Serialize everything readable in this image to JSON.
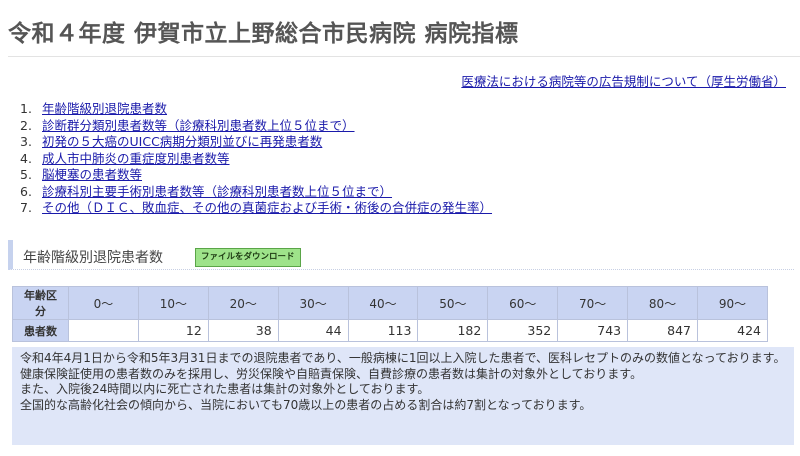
{
  "page": {
    "title": "令和４年度 伊賀市立上野総合市民病院 病院指標",
    "external_link": "医療法における病院等の広告規制について（厚生労働省）"
  },
  "toc": [
    {
      "num": "1.",
      "label": "年齢階級別退院患者数"
    },
    {
      "num": "2.",
      "label": "診断群分類別患者数等（診療科別患者数上位５位まで）"
    },
    {
      "num": "3.",
      "label": "初発の５大癌のUICC病期分類別並びに再発患者数"
    },
    {
      "num": "4.",
      "label": "成人市中肺炎の重症度別患者数等"
    },
    {
      "num": "5.",
      "label": "脳梗塞の患者数等"
    },
    {
      "num": "6.",
      "label": "診療科別主要手術別患者数等（診療科別患者数上位５位まで）"
    },
    {
      "num": "7.",
      "label": "その他（ＤＩＣ、敗血症、その他の真菌症および手術・術後の合併症の発生率）"
    }
  ],
  "section": {
    "title": "年齢階級別退院患者数",
    "download_label": "ファイルをダウンロード"
  },
  "table": {
    "header_label": "年齢区分",
    "row_label": "患者数",
    "age_groups": [
      "0～",
      "10～",
      "20～",
      "30～",
      "40～",
      "50～",
      "60～",
      "70～",
      "80～",
      "90～"
    ],
    "counts": [
      "",
      "12",
      "38",
      "44",
      "113",
      "182",
      "352",
      "743",
      "847",
      "424"
    ]
  },
  "note": [
    "令和4年4月1日から令和5年3月31日までの退院患者であり、一般病棟に1回以上入院した患者で、医科レセプトのみの数値となっております。",
    "健康保険証使用の患者数のみを採用し、労災保険や自賠責保険、自費診療の患者数は集計の対象外としております。",
    "また、入院後24時間以内に死亡された患者は集計の対象外としております。",
    "全国的な高齢化社会の傾向から、当院においても70歳以上の患者の占める割合は約7割となっております。"
  ],
  "colors": {
    "link": "#1a1aaa",
    "table_header_bg": "#c9d4f2",
    "note_bg": "#dfe6f8",
    "download_button_bg": "#9ee38a"
  }
}
